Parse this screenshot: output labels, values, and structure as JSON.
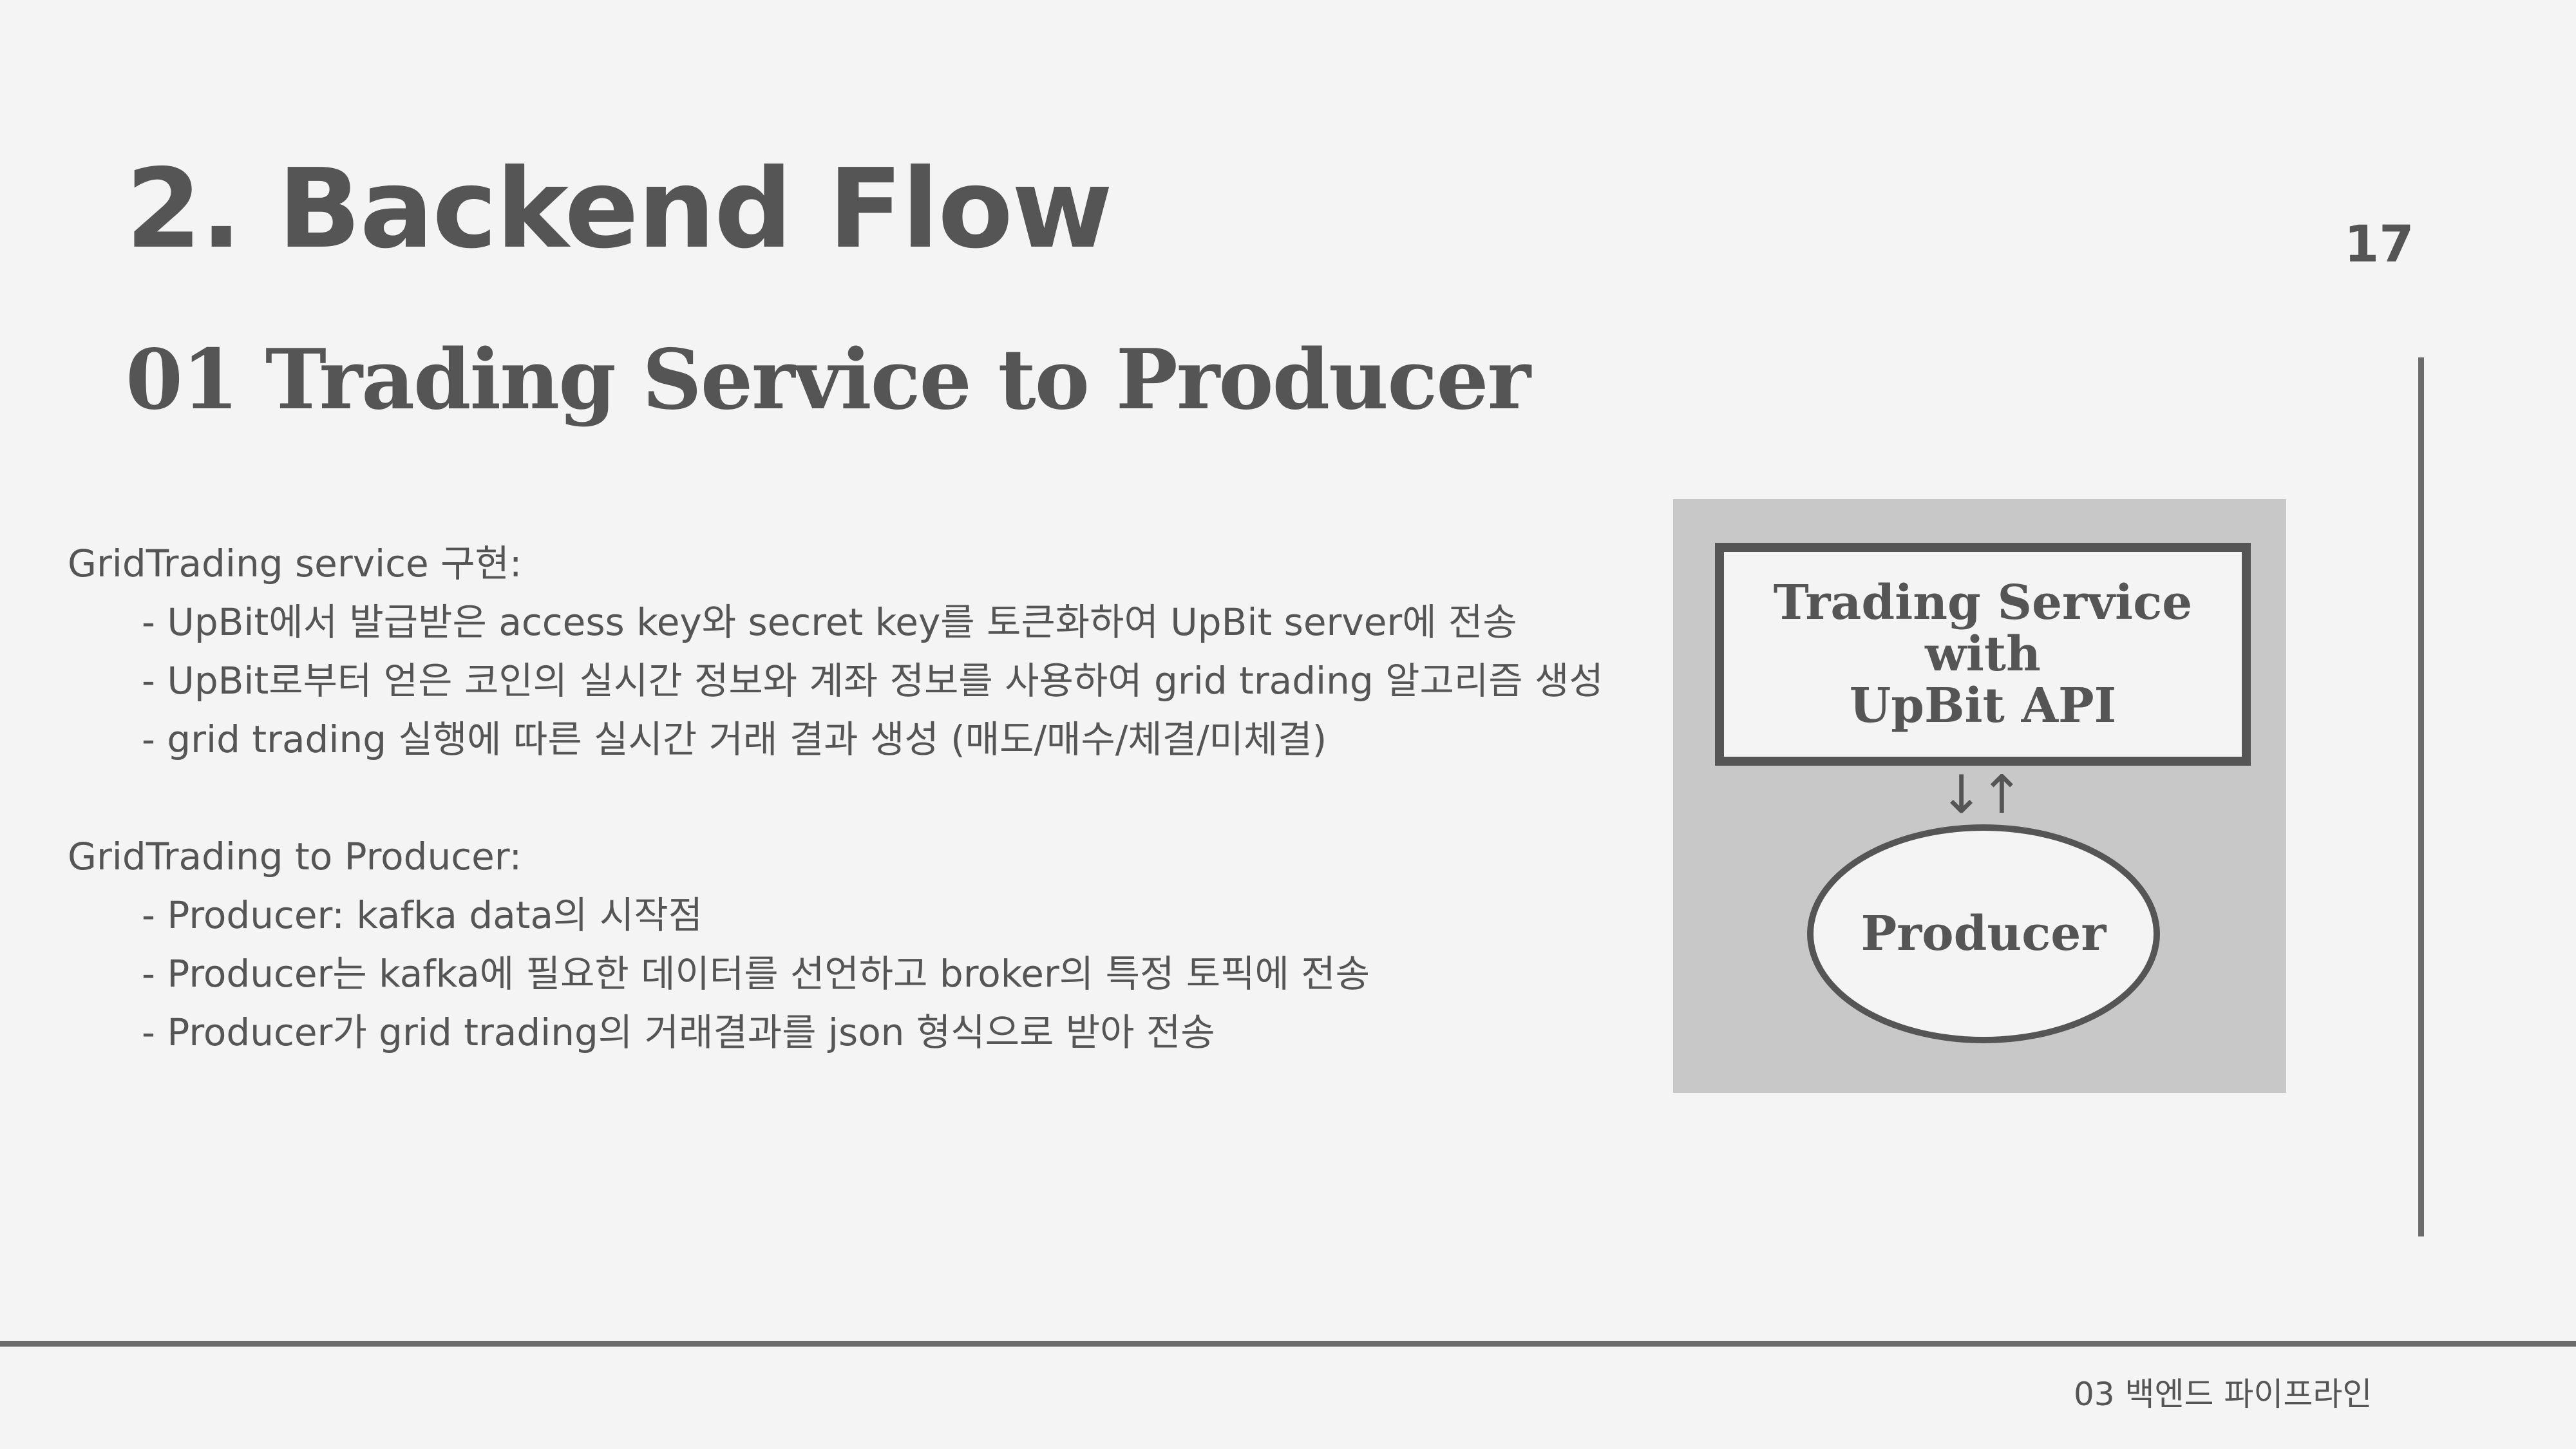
{
  "slide": {
    "title": "2. Backend Flow",
    "subtitle": "01 Trading Service to Producer",
    "page_number": "17",
    "footer": "03 백엔드 파이프라인"
  },
  "sections": [
    {
      "heading": "GridTrading service 구현:",
      "bullets": [
        "- UpBit에서 발급받은 access key와 secret key를 토큰화하여 UpBit server에 전송",
        "- UpBit로부터 얻은 코인의 실시간 정보와 계좌 정보를 사용하여 grid trading 알고리즘 생성",
        "- grid trading 실행에 따른 실시간 거래 결과 생성 (매도/매수/체결/미체결)"
      ]
    },
    {
      "heading": "GridTrading to Producer:",
      "bullets": [
        "- Producer: kafka data의 시작점",
        "- Producer는 kafka에 필요한 데이터를 선언하고 broker의 특정 토픽에 전송",
        "- Producer가 grid trading의 거래결과를 json 형식으로 받아 전송"
      ]
    }
  ],
  "diagram": {
    "service_box": {
      "line1": "Trading Service",
      "line2": "with",
      "line3": "UpBit API"
    },
    "arrows": "↓↑",
    "producer": "Producer"
  },
  "colors": {
    "background": "#f4f4f4",
    "text": "#555555",
    "diagram_panel": "#c8c8c8",
    "rule": "#6b6b6b"
  }
}
